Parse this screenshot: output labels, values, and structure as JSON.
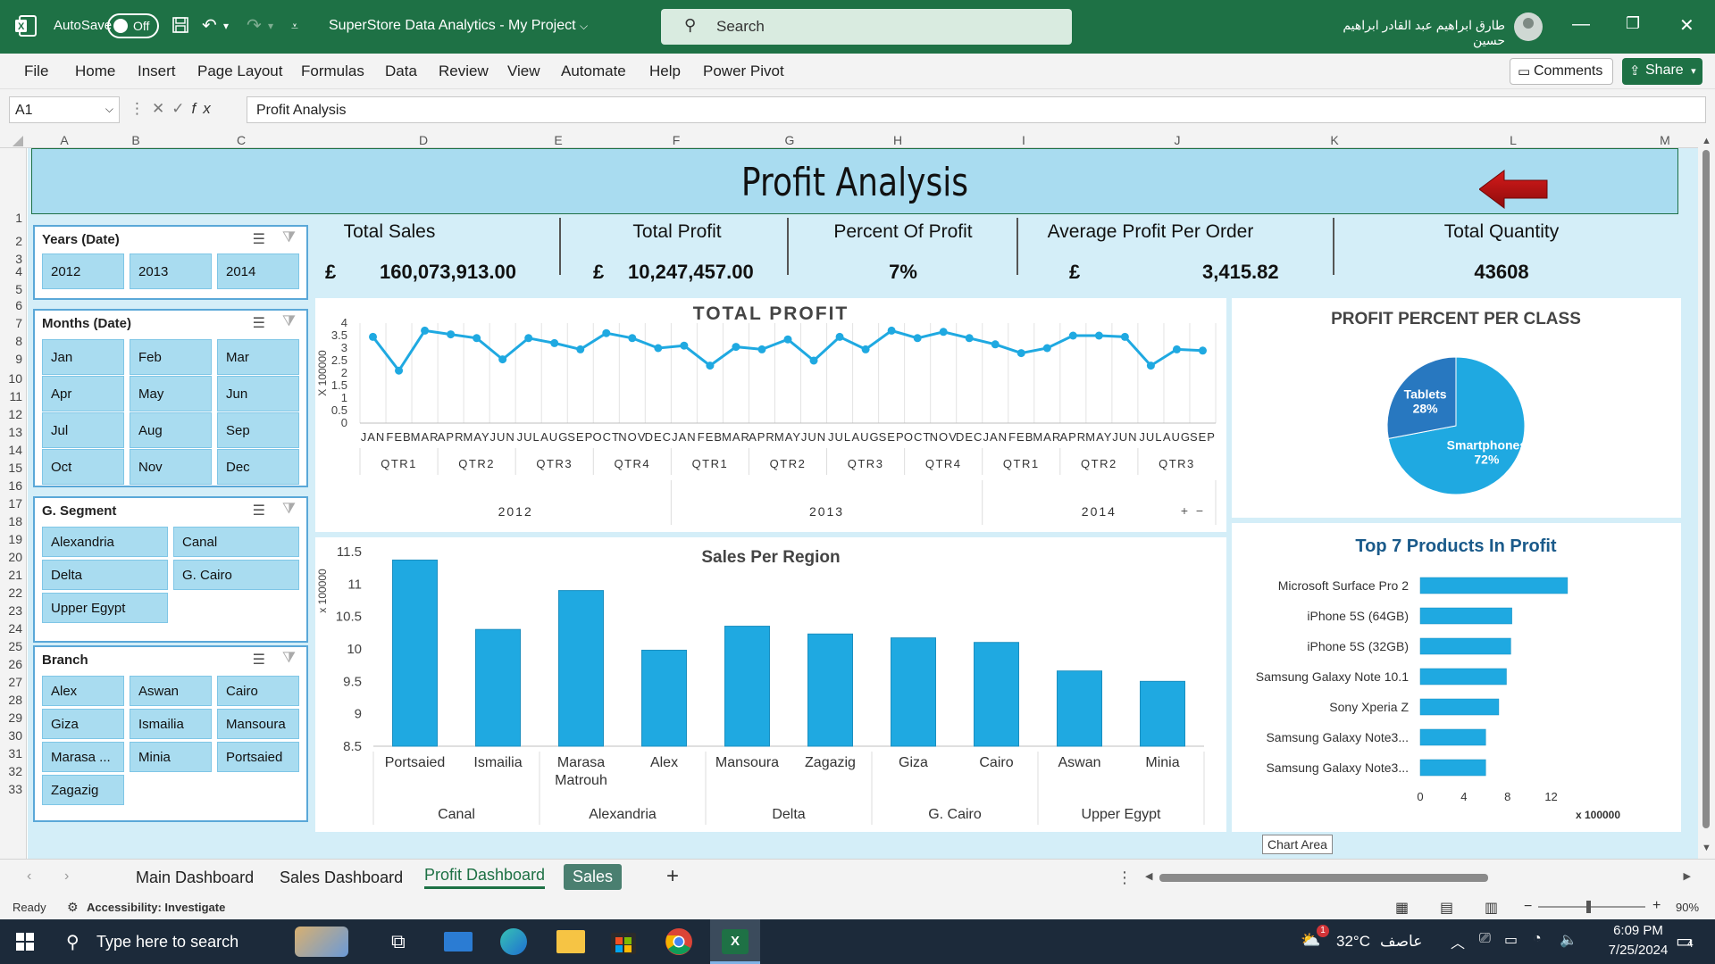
{
  "titlebar": {
    "autosave_label": "AutoSave",
    "autosave_state": "Off",
    "document_title": "SuperStore Data Analytics - My Project",
    "search_placeholder": "Search",
    "user_name": "طارق ابراهيم عبد القادر ابراهيم حسين"
  },
  "menu": [
    "File",
    "Home",
    "Insert",
    "Page Layout",
    "Formulas",
    "Data",
    "Review",
    "View",
    "Automate",
    "Help",
    "Power Pivot"
  ],
  "comments_label": "Comments",
  "share_label": "Share",
  "formula_bar": {
    "cell_ref": "A1",
    "content": "Profit Analysis"
  },
  "columns": [
    "A",
    "B",
    "C",
    "D",
    "E",
    "F",
    "G",
    "H",
    "I",
    "J",
    "K",
    "L",
    "M"
  ],
  "rows": [
    "1",
    "2",
    "3",
    "4",
    "5",
    "6",
    "7",
    "8",
    "9",
    "10",
    "11",
    "12",
    "13",
    "14",
    "15",
    "16",
    "17",
    "18",
    "19",
    "20",
    "21",
    "22",
    "23",
    "24",
    "25",
    "26",
    "27",
    "28",
    "29",
    "30",
    "31",
    "32",
    "33"
  ],
  "dashboard": {
    "title": "Profit Analysis",
    "kpis": [
      {
        "label": "Total Sales",
        "currency": "£",
        "value": "160,073,913.00"
      },
      {
        "label": "Total Profit",
        "currency": "£",
        "value": "10,247,457.00"
      },
      {
        "label": "Percent Of Profit",
        "currency": "",
        "value": "7%"
      },
      {
        "label": "Average Profit Per Order",
        "currency": "£",
        "value": "3,415.82"
      },
      {
        "label": "Total Quantity",
        "currency": "",
        "value": "43608"
      }
    ],
    "slicers": {
      "years": {
        "title": "Years (Date)",
        "items": [
          "2012",
          "2013",
          "2014"
        ]
      },
      "months": {
        "title": "Months (Date)",
        "items": [
          "Jan",
          "Feb",
          "Mar",
          "Apr",
          "May",
          "Jun",
          "Jul",
          "Aug",
          "Sep",
          "Oct",
          "Nov",
          "Dec"
        ]
      },
      "segment": {
        "title": "G. Segment",
        "items": [
          "Alexandria",
          "Canal",
          "Delta",
          "G. Cairo",
          "Upper Egypt"
        ]
      },
      "branch": {
        "title": "Branch",
        "items": [
          "Alex",
          "Aswan",
          "Cairo",
          "Giza",
          "Ismailia",
          "Mansoura",
          "Marasa ...",
          "Minia",
          "Portsaied",
          "Zagazig"
        ]
      }
    },
    "tooltip": "Chart Area"
  },
  "chart_data": [
    {
      "type": "line",
      "title": "TOTAL PROFIT",
      "ylabel": "X 100000",
      "ylim": [
        0,
        4
      ],
      "yticks": [
        "0",
        "0.5",
        "1",
        "1.5",
        "2",
        "2.5",
        "3",
        "3.5",
        "4"
      ],
      "x_months": [
        "JAN",
        "FEB",
        "MAR",
        "APR",
        "MAY",
        "JUN",
        "JUL",
        "AUG",
        "SEP",
        "OCT",
        "NOV",
        "DEC",
        "JAN",
        "FEB",
        "MAR",
        "APR",
        "MAY",
        "JUN",
        "JUL",
        "AUG",
        "SEP",
        "OCT",
        "NOV",
        "DEC",
        "JAN",
        "FEB",
        "MAR",
        "APR",
        "MAY",
        "JUN",
        "JUL",
        "AUG",
        "SEP"
      ],
      "quarters": [
        "QTR1",
        "QTR2",
        "QTR3",
        "QTR4",
        "QTR1",
        "QTR2",
        "QTR3",
        "QTR4",
        "QTR1",
        "QTR2",
        "QTR3"
      ],
      "years": [
        "2012",
        "2013",
        "2014"
      ],
      "values": [
        3.45,
        2.1,
        3.7,
        3.55,
        3.4,
        2.55,
        3.4,
        3.2,
        2.95,
        3.6,
        3.4,
        3.0,
        3.1,
        2.3,
        3.05,
        2.95,
        3.35,
        2.5,
        3.45,
        2.95,
        3.7,
        3.4,
        3.65,
        3.4,
        3.15,
        2.8,
        3.0,
        3.5,
        3.5,
        3.45,
        2.3,
        2.95,
        2.9
      ],
      "color": "#1fa9e1"
    },
    {
      "type": "bar",
      "title": "Sales Per Region",
      "ylabel": "x 100000",
      "ylim": [
        8.5,
        11.5
      ],
      "yticks": [
        "8.5",
        "9",
        "9.5",
        "10",
        "10.5",
        "11",
        "11.5"
      ],
      "categories": [
        "Portsaied",
        "Ismailia",
        "Marasa Matrouh",
        "Alex",
        "Mansoura",
        "Zagazig",
        "Giza",
        "Cairo",
        "Aswan",
        "Minia"
      ],
      "groups": [
        {
          "name": "Canal",
          "count": 2
        },
        {
          "name": "Alexandria",
          "count": 2
        },
        {
          "name": "Delta",
          "count": 2
        },
        {
          "name": "G. Cairo",
          "count": 2
        },
        {
          "name": "Upper Egypt",
          "count": 2
        }
      ],
      "values": [
        11.37,
        10.3,
        10.9,
        9.98,
        10.35,
        10.23,
        10.17,
        10.1,
        9.66,
        9.5
      ],
      "color": "#1fa9e1"
    },
    {
      "type": "pie",
      "title": "PROFIT PERCENT PER CLASS",
      "categories": [
        "Smartphones",
        "Tablets"
      ],
      "values": [
        72,
        28
      ],
      "labels": [
        "Smartphones 72%",
        "Tablets 28%"
      ],
      "colors": [
        "#1fa9e1",
        "#2878c0"
      ]
    },
    {
      "type": "bar",
      "orientation": "horizontal",
      "title": "Top 7 Products In Profit",
      "xlabel": "x 100000",
      "xlim": [
        0,
        14
      ],
      "xticks": [
        "0",
        "4",
        "8",
        "12"
      ],
      "categories": [
        "Microsoft Surface Pro 2",
        "iPhone 5S (64GB)",
        "iPhone 5S (32GB)",
        "Samsung Galaxy Note 10.1",
        "Sony Xperia Z",
        "Samsung Galaxy Note3...",
        "Samsung Galaxy Note3..."
      ],
      "values": [
        13.5,
        8.4,
        8.3,
        7.9,
        7.2,
        6.0,
        6.0
      ],
      "color": "#1fa9e1"
    }
  ],
  "sheet_tabs": [
    "Main Dashboard",
    "Sales Dashboard",
    "Profit Dashboard",
    "Sales"
  ],
  "active_sheet": "Profit Dashboard",
  "status": {
    "ready": "Ready",
    "accessibility": "Accessibility: Investigate",
    "zoom": "90%"
  },
  "taskbar": {
    "search_placeholder": "Type here to search",
    "weather": "32°C",
    "weather_desc": "عاصف",
    "time": "6:09 PM",
    "date": "7/25/2024",
    "notification_count": "4",
    "weather_badge": "1"
  }
}
